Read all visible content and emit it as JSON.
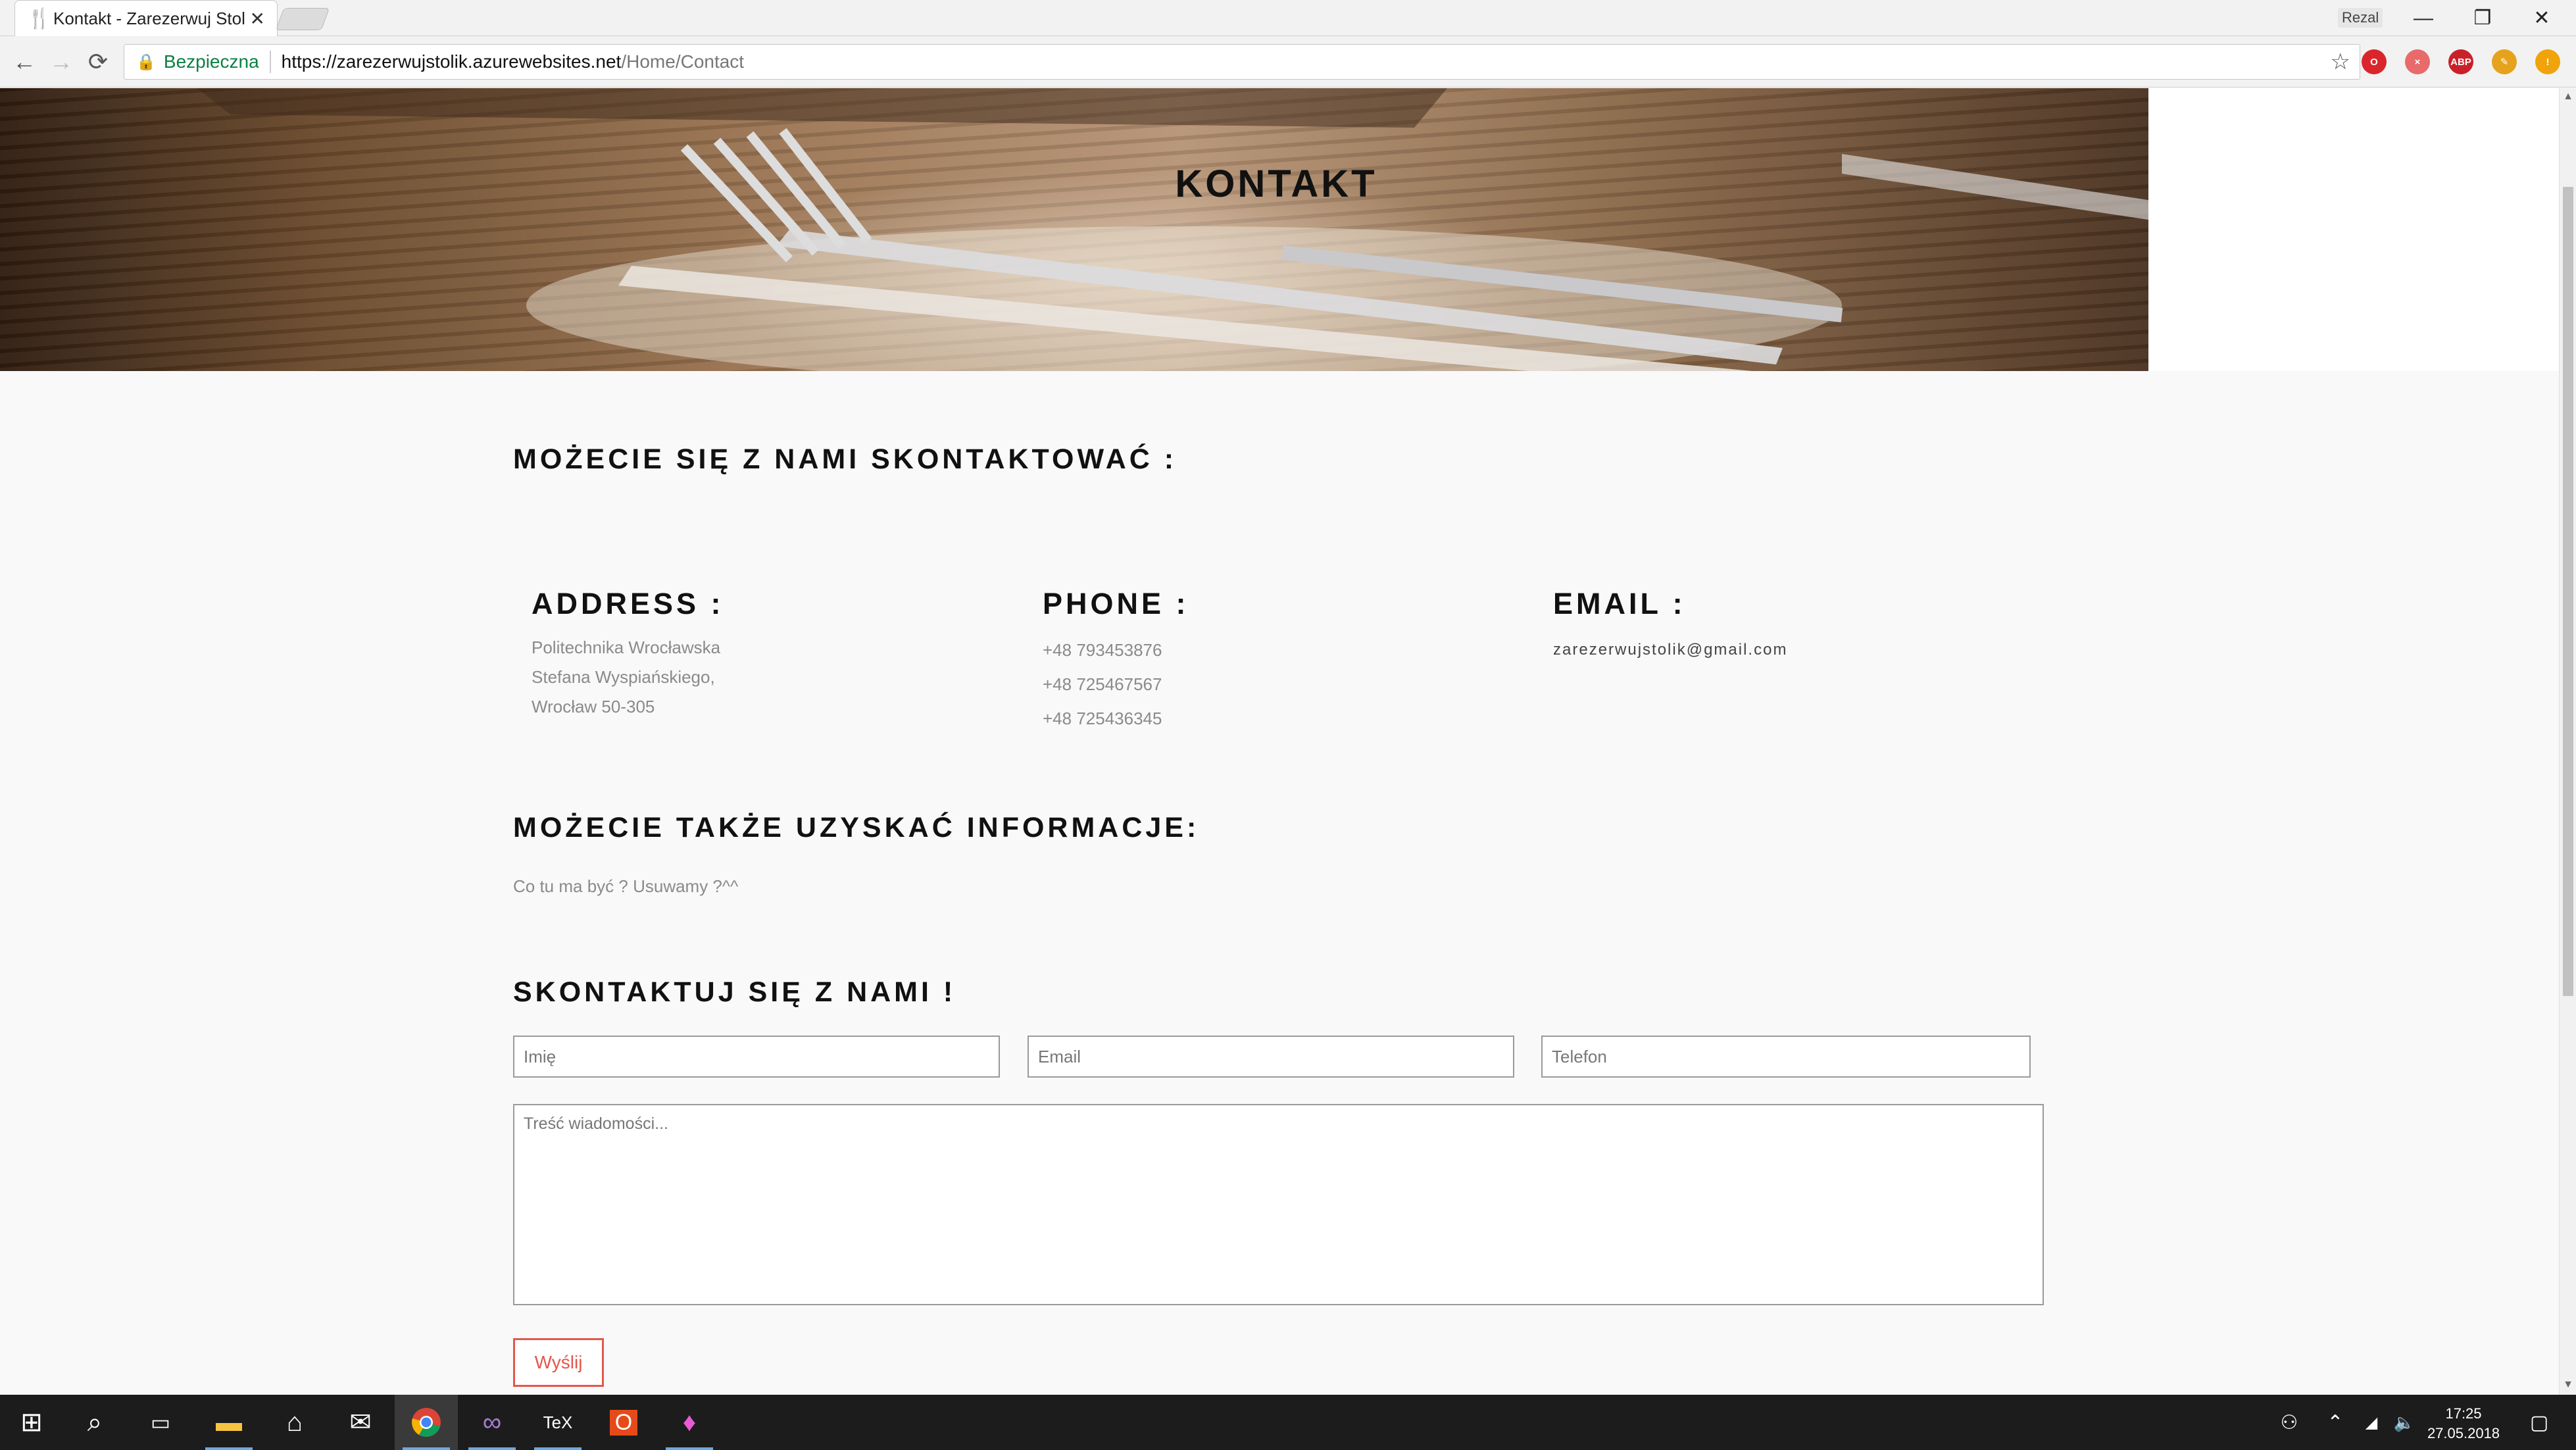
{
  "browser": {
    "tab_title": "Kontakt - Zarezerwuj Stol",
    "profile_name": "Rezal",
    "secure_label": "Bezpieczna",
    "url_host": "https://zarezerwujstolik.azurewebsites.net",
    "url_path": "/Home/Contact",
    "extensions": [
      {
        "name": "opera-icon",
        "color": "#d9262c",
        "label": "O"
      },
      {
        "name": "blocker-icon",
        "color": "#e86a6a",
        "label": "×"
      },
      {
        "name": "adblock-icon",
        "color": "#c9202a",
        "label": "ABP"
      },
      {
        "name": "pen-icon",
        "color": "#e6a21c",
        "label": "✎"
      },
      {
        "name": "alert-icon",
        "color": "#f0a30a",
        "label": "!"
      }
    ]
  },
  "hero": {
    "title": "KONTAKT"
  },
  "contact": {
    "heading": "MOŻECIE SIĘ Z NAMI SKONTAKTOWAĆ :",
    "address": {
      "heading": "ADDRESS :",
      "lines": [
        "Politechnika Wrocławska",
        "Stefana Wyspiańskiego,",
        "Wrocław 50-305"
      ]
    },
    "phone": {
      "heading": "PHONE :",
      "lines": [
        "+48 793453876",
        "+48 725467567",
        "+48 725436345"
      ]
    },
    "email": {
      "heading": "EMAIL :",
      "value": "zarezerwujstolik@gmail.com"
    }
  },
  "info": {
    "heading": "MOŻECIE TAKŻE UZYSKAĆ INFORMACJE:",
    "text": "Co tu ma być ? Usuwamy ?^^"
  },
  "form": {
    "heading": "SKONTAKTUJ SIĘ Z NAMI !",
    "name_placeholder": "Imię",
    "email_placeholder": "Email",
    "phone_placeholder": "Telefon",
    "message_placeholder": "Treść wiadomości...",
    "submit_label": "Wyślij"
  },
  "taskbar": {
    "time": "17:25",
    "date": "27.05.2018"
  }
}
